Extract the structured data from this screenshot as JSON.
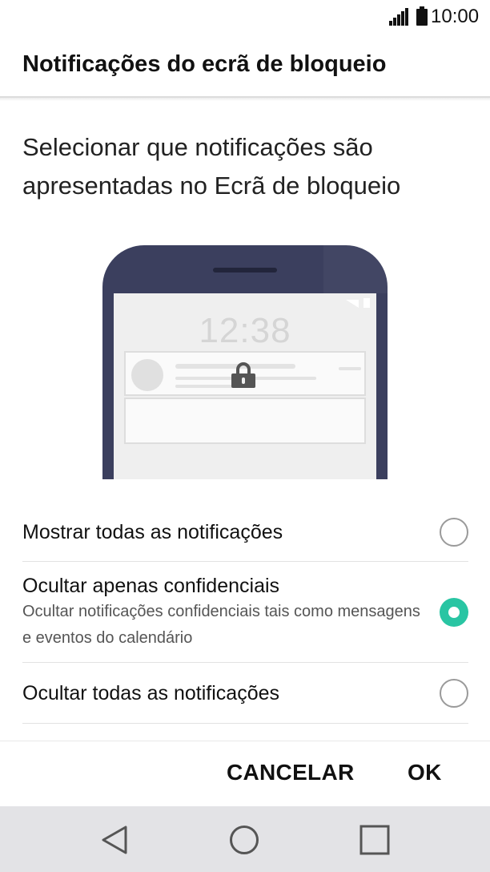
{
  "status_bar": {
    "time": "10:00",
    "icons": [
      "signal-icon",
      "battery-icon"
    ]
  },
  "header": {
    "title": "Notificações do ecrã de bloqueio"
  },
  "description": "Selecionar que notificações são apresentadas no Ecrã de bloqueio",
  "illustration": {
    "lock_screen_time": "12:38",
    "icons": [
      "lock-icon"
    ]
  },
  "options": [
    {
      "label": "Mostrar todas as notificações",
      "sublabel": "",
      "selected": false
    },
    {
      "label": "Ocultar apenas confidenciais",
      "sublabel": "Ocultar notificações confidenciais tais como mensagens e eventos do calendário",
      "selected": true
    },
    {
      "label": "Ocultar todas as notificações",
      "sublabel": "",
      "selected": false
    }
  ],
  "actions": {
    "cancel_label": "CANCELAR",
    "ok_label": "OK"
  },
  "nav_bar": {
    "icons": [
      "back-icon",
      "home-icon",
      "recents-icon"
    ]
  },
  "colors": {
    "accent": "#29c5a3",
    "phone_frame": "#3b3f5e",
    "nav_background": "#e3e3e6"
  }
}
